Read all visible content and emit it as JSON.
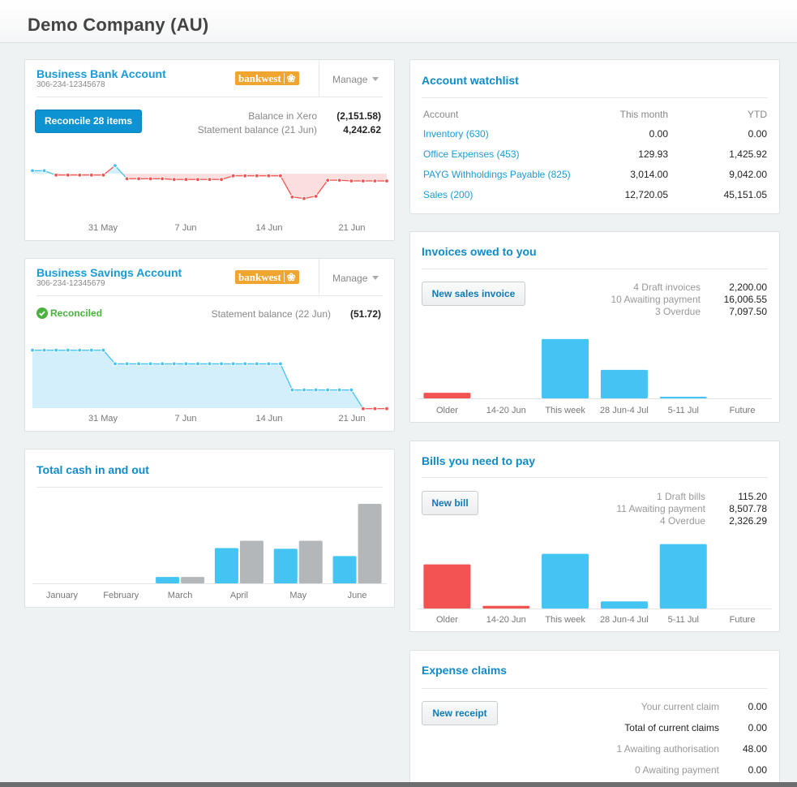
{
  "header": {
    "title": "Demo Company (AU)"
  },
  "bank_account": {
    "title": "Business Bank Account",
    "number": "306-234-12345678",
    "bank_logo": "bankwest",
    "manage_label": "Manage",
    "reconcile_label": "Reconcile 28 items",
    "balance_xero_label": "Balance in Xero",
    "balance_xero_value": "(2,151.58)",
    "statement_label": "Statement balance (21 Jun)",
    "statement_value": "4,242.62",
    "chart_x_labels": [
      "31 May",
      "7 Jun",
      "14 Jun",
      "21 Jun"
    ]
  },
  "savings_account": {
    "title": "Business Savings Account",
    "number": "306-234-12345679",
    "bank_logo": "bankwest",
    "manage_label": "Manage",
    "status_label": "Reconciled",
    "statement_label": "Statement balance (22 Jun)",
    "statement_value": "(51.72)",
    "chart_x_labels": [
      "31 May",
      "7 Jun",
      "14 Jun",
      "21 Jun"
    ]
  },
  "cash_in_out": {
    "title": "Total cash in and out"
  },
  "watchlist": {
    "title": "Account watchlist",
    "columns": [
      "Account",
      "This month",
      "YTD"
    ],
    "rows": [
      {
        "account": "Inventory (630)",
        "month": "0.00",
        "ytd": "0.00"
      },
      {
        "account": "Office Expenses (453)",
        "month": "129.93",
        "ytd": "1,425.92"
      },
      {
        "account": "PAYG Withholdings Payable (825)",
        "month": "3,014.00",
        "ytd": "9,042.00"
      },
      {
        "account": "Sales (200)",
        "month": "12,720.05",
        "ytd": "45,151.05"
      }
    ]
  },
  "invoices": {
    "title": "Invoices owed to you",
    "button_label": "New sales invoice",
    "summary": [
      {
        "label": "4 Draft invoices",
        "value": "2,200.00"
      },
      {
        "label": "10 Awaiting payment",
        "value": "16,006.55"
      },
      {
        "label": "3 Overdue",
        "value": "7,097.50"
      }
    ]
  },
  "bills": {
    "title": "Bills you need to pay",
    "button_label": "New bill",
    "summary": [
      {
        "label": "1 Draft bills",
        "value": "115.20"
      },
      {
        "label": "11 Awaiting payment",
        "value": "8,507.78"
      },
      {
        "label": "4 Overdue",
        "value": "2,326.29"
      }
    ]
  },
  "expenses": {
    "title": "Expense claims",
    "button_label": "New receipt",
    "summary": [
      {
        "label": "Your current claim",
        "value": "0.00",
        "emphasis": false
      },
      {
        "label": "Total of current claims",
        "value": "0.00",
        "emphasis": true
      },
      {
        "label": "1 Awaiting authorisation",
        "value": "48.00",
        "emphasis": false
      },
      {
        "label": "0 Awaiting payment",
        "value": "0.00",
        "emphasis": false
      }
    ]
  },
  "colors": {
    "accent": "#0f8bc8",
    "positive": "#43c4f3",
    "negative": "#f45353",
    "neutral": "#b3b7ba",
    "success": "#4ab23e",
    "bank": "#f0a531"
  },
  "chart_data": [
    {
      "id": "bank_balance",
      "type": "line",
      "title": "Business Bank Account balance",
      "x_ticks": [
        "31 May",
        "7 Jun",
        "14 Jun",
        "21 Jun"
      ],
      "note": "relative balance levels per day, baseline 0; positive blue, negative red",
      "values": [
        0.4,
        0.4,
        -0.2,
        -0.2,
        -0.2,
        -0.2,
        -0.2,
        1.1,
        -0.7,
        -0.7,
        -0.7,
        -0.7,
        -0.8,
        -0.8,
        -0.8,
        -0.8,
        -0.8,
        -0.3,
        -0.3,
        -0.3,
        -0.3,
        -0.3,
        -3.2,
        -3.4,
        -3.1,
        -0.9,
        -0.9,
        -1.0,
        -1.0,
        -1.0,
        -1.0
      ],
      "baseline": 0
    },
    {
      "id": "savings_balance",
      "type": "area",
      "title": "Business Savings Account balance",
      "x_ticks": [
        "31 May",
        "7 Jun",
        "14 Jun",
        "21 Jun"
      ],
      "values": [
        5.1,
        5.1,
        5.1,
        5.1,
        5.1,
        5.1,
        5.1,
        3.9,
        3.9,
        3.9,
        3.9,
        3.9,
        3.9,
        3.9,
        3.9,
        3.9,
        3.9,
        3.9,
        3.9,
        3.9,
        3.9,
        3.9,
        1.6,
        1.6,
        1.6,
        1.6,
        1.6,
        1.6,
        -0.05,
        -0.05,
        -0.05
      ],
      "baseline": 0
    },
    {
      "id": "cash_in_out",
      "type": "bar",
      "title": "Total cash in and out",
      "categories": [
        "January",
        "February",
        "March",
        "April",
        "May",
        "June"
      ],
      "series": [
        {
          "name": "Cash in",
          "color": "#43c4f3",
          "values": [
            0,
            0,
            8,
            44,
            43,
            34
          ]
        },
        {
          "name": "Cash out",
          "color": "#b3b7ba",
          "values": [
            0,
            0,
            8,
            53,
            53,
            99
          ]
        }
      ],
      "ylim": [
        0,
        100
      ]
    },
    {
      "id": "invoices_owed",
      "type": "bar",
      "title": "Invoices owed to you",
      "categories": [
        "Older",
        "14-20 Jun",
        "This week",
        "28 Jun-4 Jul",
        "5-11 Jul",
        "Future"
      ],
      "values": [
        7,
        0,
        75,
        36,
        2,
        0
      ],
      "colors": [
        "#f45353",
        "#f45353",
        "#43c4f3",
        "#43c4f3",
        "#43c4f3",
        "#43c4f3"
      ],
      "ylim": [
        0,
        80
      ]
    },
    {
      "id": "bills_to_pay",
      "type": "bar",
      "title": "Bills you need to pay",
      "categories": [
        "Older",
        "14-20 Jun",
        "This week",
        "28 Jun-4 Jul",
        "5-11 Jul",
        "Future"
      ],
      "values": [
        50,
        3,
        62,
        8,
        73,
        0
      ],
      "colors": [
        "#f45353",
        "#f45353",
        "#43c4f3",
        "#43c4f3",
        "#43c4f3",
        "#43c4f3"
      ],
      "ylim": [
        0,
        80
      ]
    }
  ]
}
